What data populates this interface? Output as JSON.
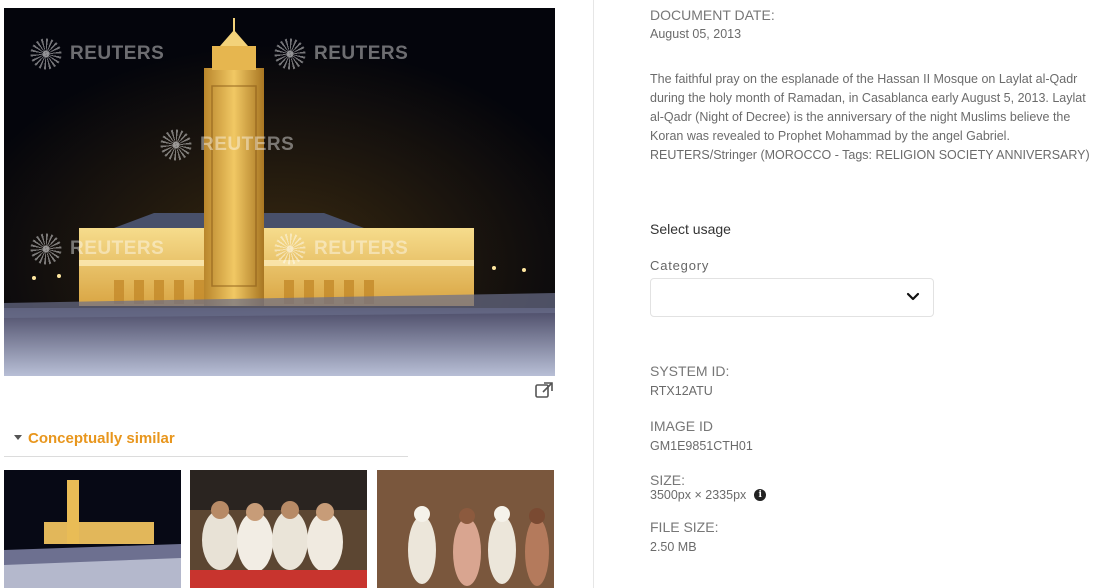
{
  "main_image": {
    "watermark": "REUTERS"
  },
  "similar": {
    "heading": "Conceptually similar"
  },
  "details": {
    "document_date_label": "DOCUMENT DATE:",
    "document_date": "August 05, 2013",
    "caption": "The faithful pray on the esplanade of the Hassan II Mosque on Laylat al-Qadr during the holy month of Ramadan, in Casablanca early August 5, 2013. Laylat al-Qadr (Night of Decree) is the anniversary of the night Muslims believe the Koran was revealed to Prophet Mohammad by the angel Gabriel. REUTERS/Stringer (MOROCCO - Tags: RELIGION SOCIETY ANNIVERSARY)",
    "select_usage": "Select usage",
    "category_label": "Category",
    "category_value": "",
    "system_id_label": "SYSTEM ID:",
    "system_id": "RTX12ATU",
    "image_id_label": "IMAGE ID",
    "image_id": "GM1E9851CTH01",
    "size_label": "SIZE:",
    "size": "3500px × 2335px",
    "file_size_label": "FILE SIZE:",
    "file_size": "2.50 MB"
  },
  "icons": {
    "open_external": "external-link-icon",
    "collapse": "caret-down-icon",
    "dropdown": "chevron-down-icon",
    "info": "info-icon"
  },
  "colors": {
    "accent": "#e8961d",
    "label": "#777777",
    "value": "#6b6b6b"
  }
}
